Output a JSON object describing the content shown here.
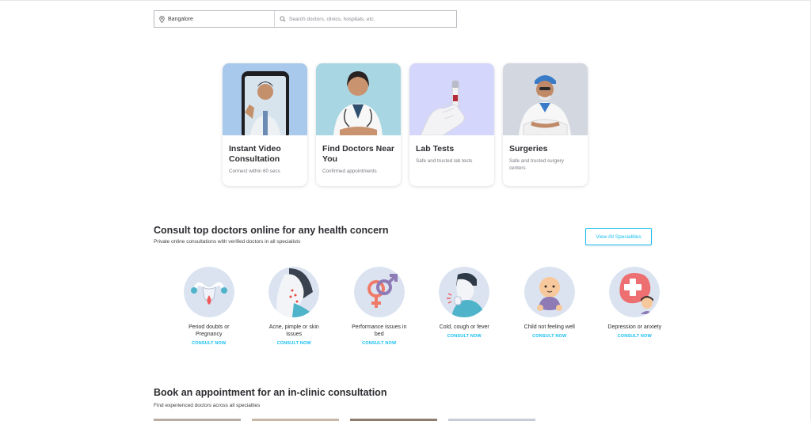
{
  "search": {
    "location_value": "Bangalore",
    "query_placeholder": "Search doctors, clinics, hospitals, etc."
  },
  "service_cards": [
    {
      "title": "Instant Video Consultation",
      "subtitle": "Connect within 60 secs",
      "icon": "video-consult-illustration"
    },
    {
      "title": "Find Doctors Near You",
      "subtitle": "Confirmed appointments",
      "icon": "doctor-illustration"
    },
    {
      "title": "Lab Tests",
      "subtitle": "Safe and trusted lab tests",
      "icon": "lab-test-illustration"
    },
    {
      "title": "Surgeries",
      "subtitle": "Safe and trusted surgery centers",
      "icon": "surgeon-illustration"
    }
  ],
  "consult_section": {
    "title": "Consult top doctors online for any health concern",
    "subtitle": "Private online consultations with verified doctors in all specialists",
    "view_all_label": "View All Specialities",
    "items": [
      {
        "label": "Period doubts or Pregnancy",
        "cta": "CONSULT NOW",
        "icon": "uterus-icon"
      },
      {
        "label": "Acne, pimple or skin issues",
        "cta": "CONSULT NOW",
        "icon": "acne-face-icon"
      },
      {
        "label": "Performance issues in bed",
        "cta": "CONSULT NOW",
        "icon": "gender-symbols-icon"
      },
      {
        "label": "Cold, cough or fever",
        "cta": "CONSULT NOW",
        "icon": "coughing-person-icon"
      },
      {
        "label": "Child not feeling well",
        "cta": "CONSULT NOW",
        "icon": "baby-icon"
      },
      {
        "label": "Depression or anxiety",
        "cta": "CONSULT NOW",
        "icon": "mental-health-icon"
      }
    ]
  },
  "clinic_section": {
    "title": "Book an appointment for an in-clinic consultation",
    "subtitle": "Find experienced doctors across all specialties"
  },
  "colors": {
    "accent": "#14bef0",
    "heading": "#2d2d32",
    "text": "#414146"
  }
}
